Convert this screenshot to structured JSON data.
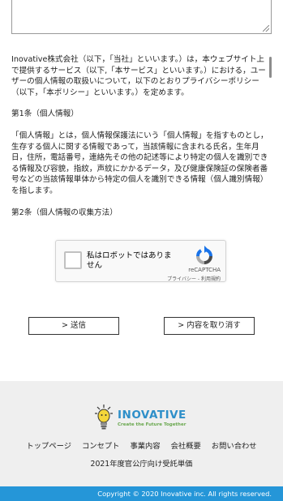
{
  "policy": {
    "intro": "Inovative株式会社（以下，「当社」といいます。）は，本ウェブサイト上で提供するサービス（以下,「本サービス」といいます。）における，ユーザーの個人情報の取扱いについて，以下のとおりプライバシーポリシー（以下，「本ポリシー」といいます。）を定めます。",
    "article1_title": "第1条（個人情報）",
    "article1_body": "「個人情報」とは，個人情報保護法にいう「個人情報」を指すものとし，生存する個人に関する情報であって，当該情報に含まれる氏名，生年月日，住所，電話番号，連絡先その他の記述等により特定の個人を識別できる情報及び容貌，指紋，声紋にかかるデータ，及び健康保険証の保険者番号などの当該情報単体から特定の個人を識別できる情報（個人識別情報）を指します。",
    "article2_title": "第2条（個人情報の収集方法）"
  },
  "recaptcha": {
    "label": "私はロボットではありません",
    "brand": "reCAPTCHA",
    "privacy_link": "プライバシー",
    "separator": " - ",
    "terms_link": "利用規約"
  },
  "buttons": {
    "send": "> 送信",
    "cancel": "> 内容を取り消す"
  },
  "footer": {
    "logo_text": "INOVATIVE",
    "logo_tagline": "Create the Future Together",
    "nav": [
      "トップページ",
      "コンセプト",
      "事業内容",
      "会社概要",
      "お問い合わせ"
    ],
    "sub_link": "2021年度官公庁向け受託単価",
    "copyright": "Copyright © 2020 Inovative inc. All rights reserved."
  },
  "colors": {
    "accent": "#2596d8",
    "footer_bg": "#efefef",
    "logo_blue": "#2e8fc9",
    "logo_green": "#6aa84f"
  },
  "icons": {
    "recaptcha_logo": "recaptcha-logo-icon",
    "logo_bulb": "lightbulb-icon",
    "resize_handle": "resize-handle-icon"
  }
}
